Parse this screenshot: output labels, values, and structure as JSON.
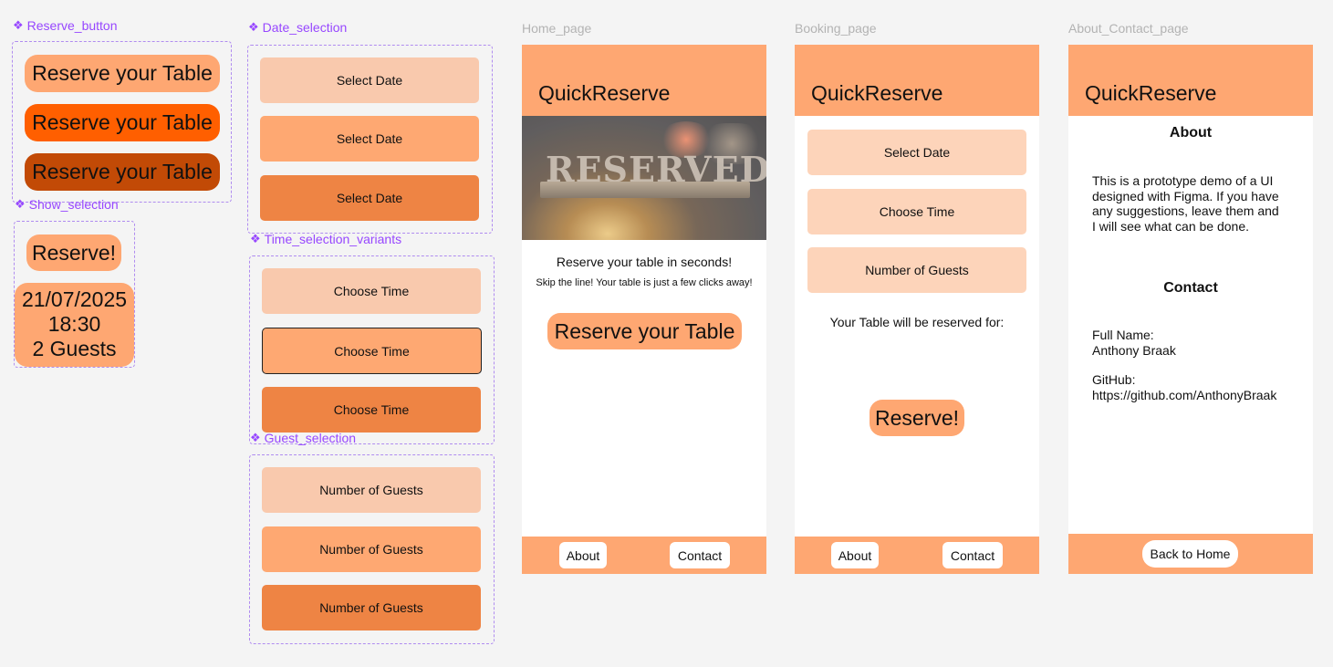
{
  "components": {
    "reserve_button": {
      "label": "Reserve_button",
      "variants": [
        "Reserve your Table",
        "Reserve your Table",
        "Reserve your Table"
      ]
    },
    "show_selection": {
      "label": "Show_selection",
      "button": "Reserve!",
      "date": "21/07/2025",
      "time": "18:30",
      "guests": "2 Guests"
    },
    "date_selection": {
      "label": "Date_selection",
      "variants": [
        "Select Date",
        "Select Date",
        "Select Date"
      ]
    },
    "time_selection": {
      "label": "Time_selection_variants",
      "variants": [
        "Choose Time",
        "Choose Time",
        "Choose Time"
      ]
    },
    "guest_selection": {
      "label": "Guest_selection",
      "variants": [
        "Number of Guests",
        "Number of Guests",
        "Number of Guests"
      ]
    }
  },
  "home_page": {
    "frame_label": "Home_page",
    "brand": "QuickReserve",
    "image_text": "RESERVED",
    "headline": "Reserve your table in seconds!",
    "subline": "Skip the line! Your table is just a few clicks away!",
    "cta": "Reserve your Table",
    "nav": [
      "About",
      "Contact"
    ]
  },
  "booking_page": {
    "frame_label": "Booking_page",
    "brand": "QuickReserve",
    "date_btn": "Select Date",
    "time_btn": "Choose Time",
    "guests_btn": "Number of Guests",
    "summary": "Your Table will be reserved for:",
    "reserve": "Reserve!",
    "nav": [
      "About",
      "Contact"
    ]
  },
  "about_page": {
    "frame_label": "About_Contact_page",
    "brand": "QuickReserve",
    "about_title": "About",
    "about_text": [
      "This is a prototype demo of a UI",
      "designed with Figma. If you have",
      "any suggestions, leave them and",
      "I will see what can be done."
    ],
    "contact_title": "Contact",
    "name_label": "Full Name:",
    "name_value": "Anthony Braak",
    "github_label": "GitHub:",
    "github_value": "https://github.com/AnthonyBraak",
    "back": "Back to Home"
  },
  "colors": {
    "accent": "#fea772",
    "accent_light": "#f9c9ad",
    "accent_dark": "#ee8444",
    "reserve_hover": "#ff5f00",
    "reserve_pressed": "#c24a06",
    "component_border": "#9747ff"
  }
}
